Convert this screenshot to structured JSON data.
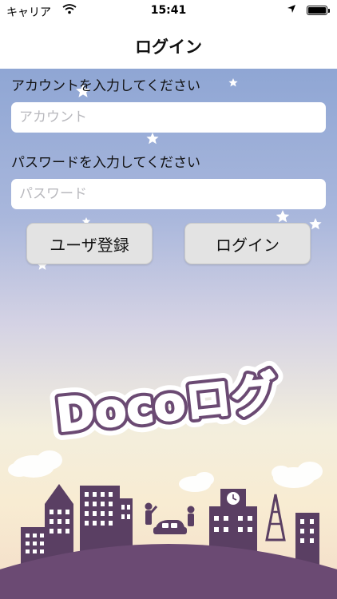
{
  "status_bar": {
    "carrier": "キャリア",
    "time": "15:41",
    "wifi_icon": "wifi-icon",
    "location_icon": "location-arrow-icon",
    "battery_icon": "battery-full-icon"
  },
  "nav": {
    "title": "ログイン"
  },
  "form": {
    "account_label": "アカウントを入力してください",
    "account_placeholder": "アカウント",
    "account_value": "",
    "password_label": "パスワードを入力してください",
    "password_placeholder": "パスワード",
    "password_value": ""
  },
  "buttons": {
    "register_label": "ユーザ登録",
    "login_label": "ログイン"
  },
  "logo": {
    "text": "Docoログ"
  },
  "colors": {
    "sky_top": "#8fa6d4",
    "sky_bottom": "#f3dcc8",
    "city": "#5a3f63",
    "ground": "#6b4a73",
    "logo_outline": "#6b4a73"
  }
}
